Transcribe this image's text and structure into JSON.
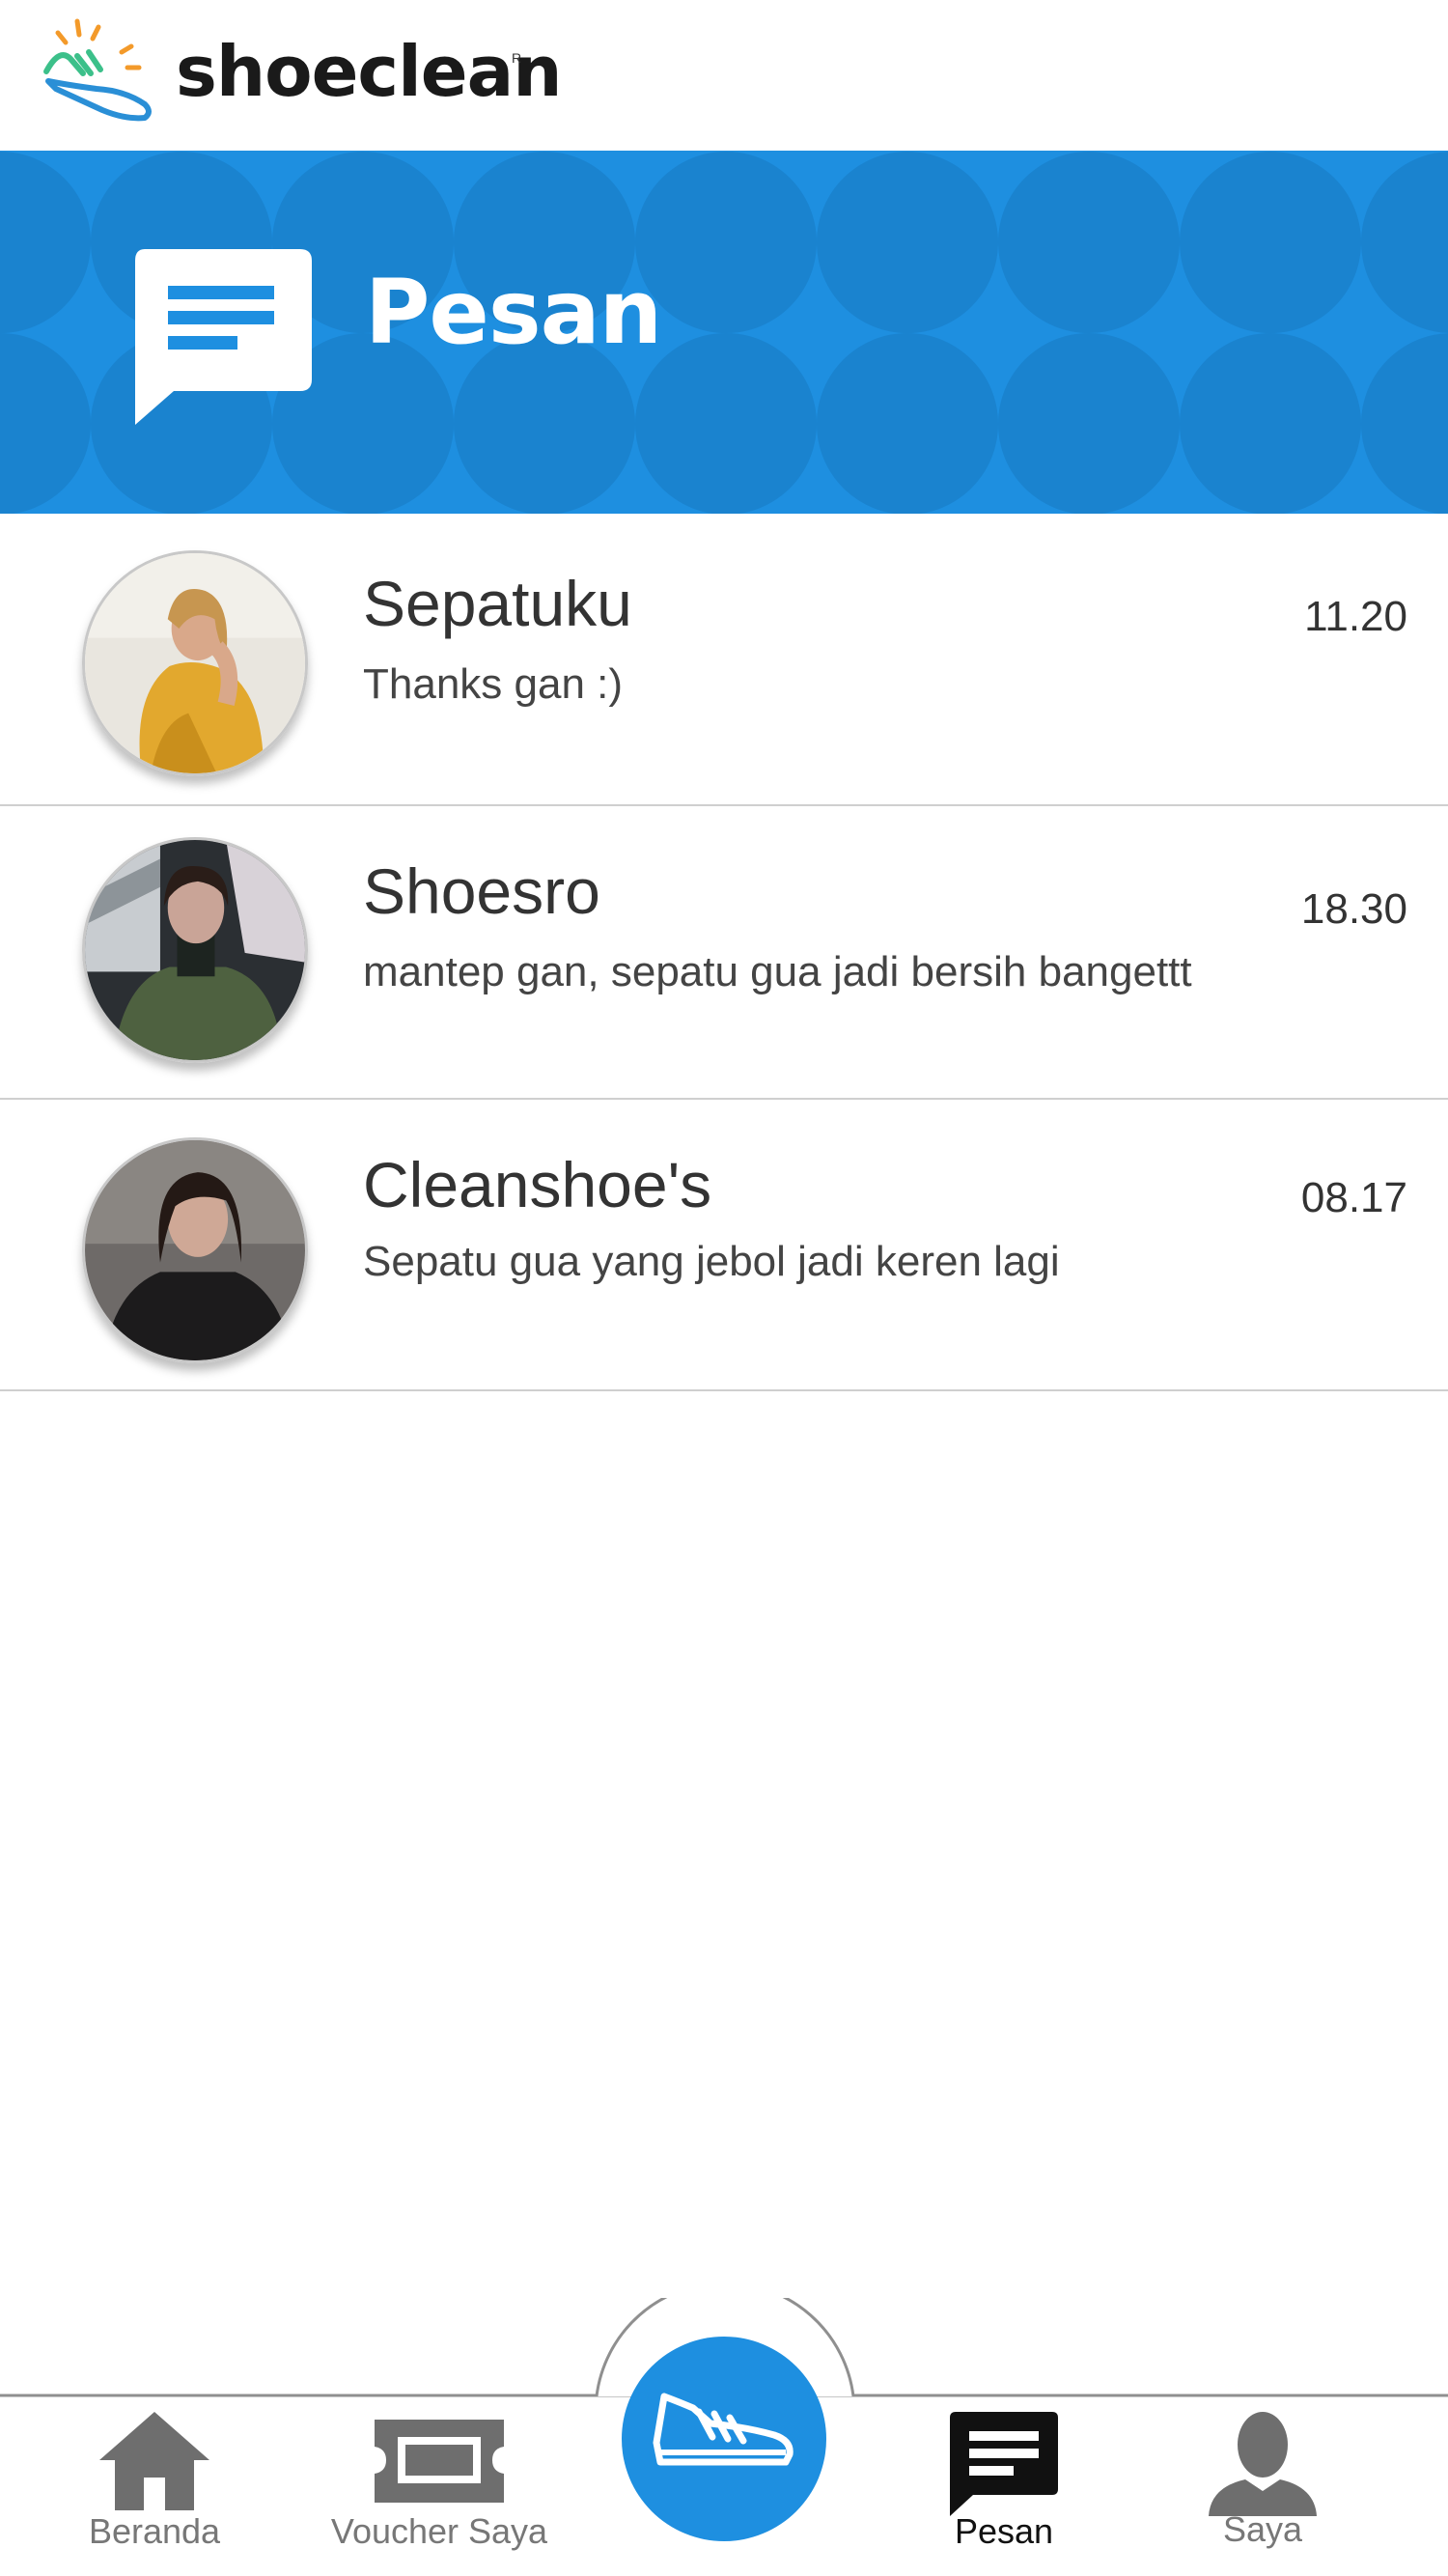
{
  "app": {
    "brand_name": "shoeclean",
    "brand_mark": "R",
    "accent_color": "#1e8fe0"
  },
  "header": {
    "title": "Pesan",
    "icon": "message-icon"
  },
  "messages": [
    {
      "name": "Sepatuku",
      "preview": "Thanks gan :)",
      "time": "11.20",
      "avatar": "avatar-woman-yellow-jacket"
    },
    {
      "name": "Shoesro",
      "preview": "mantep gan, sepatu gua jadi bersih bangettt",
      "time": "18.30",
      "avatar": "avatar-woman-green-turtleneck"
    },
    {
      "name": "Cleanshoe's",
      "preview": "Sepatu gua yang jebol jadi keren lagi",
      "time": "08.17",
      "avatar": "avatar-woman-dark-hair"
    }
  ],
  "nav": {
    "items": [
      {
        "label": "Beranda",
        "icon": "home-icon"
      },
      {
        "label": "Voucher Saya",
        "icon": "ticket-icon"
      },
      {
        "label": "",
        "icon": "shoe-icon"
      },
      {
        "label": "Pesan",
        "icon": "chat-icon",
        "active": true
      },
      {
        "label": "Saya",
        "icon": "person-icon"
      }
    ]
  }
}
